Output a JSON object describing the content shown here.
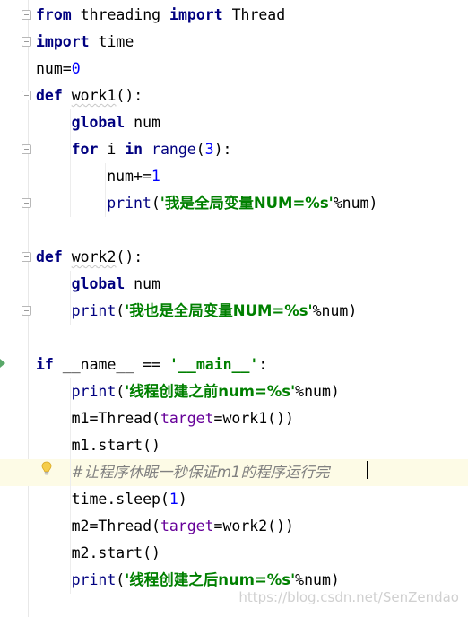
{
  "editor": {
    "language": "python",
    "lines": [
      {
        "indent": 0,
        "tokens": [
          {
            "t": "from",
            "c": "kw"
          },
          {
            "t": " threading "
          },
          {
            "t": "import",
            "c": "kw"
          },
          {
            "t": " Thread"
          }
        ]
      },
      {
        "indent": 0,
        "tokens": [
          {
            "t": "import",
            "c": "kw"
          },
          {
            "t": " time"
          }
        ]
      },
      {
        "indent": 0,
        "tokens": [
          {
            "t": "num="
          },
          {
            "t": "0",
            "c": "num"
          }
        ]
      },
      {
        "indent": 0,
        "tokens": [
          {
            "t": "def",
            "c": "kw"
          },
          {
            "t": " "
          },
          {
            "t": "work1",
            "c": "squig"
          },
          {
            "t": "():"
          }
        ]
      },
      {
        "indent": 1,
        "tokens": [
          {
            "t": "global",
            "c": "kw"
          },
          {
            "t": " num"
          }
        ]
      },
      {
        "indent": 1,
        "tokens": [
          {
            "t": "for",
            "c": "kw"
          },
          {
            "t": " i "
          },
          {
            "t": "in",
            "c": "kw"
          },
          {
            "t": " "
          },
          {
            "t": "range",
            "c": "builtin"
          },
          {
            "t": "("
          },
          {
            "t": "3",
            "c": "num"
          },
          {
            "t": "):"
          }
        ]
      },
      {
        "indent": 2,
        "tokens": [
          {
            "t": "num+="
          },
          {
            "t": "1",
            "c": "num"
          }
        ]
      },
      {
        "indent": 2,
        "tokens": [
          {
            "t": "print",
            "c": "builtin"
          },
          {
            "t": "("
          },
          {
            "t": "'我是全局变量NUM=%s'",
            "c": "str"
          },
          {
            "t": "%num)"
          }
        ]
      },
      {
        "indent": 0,
        "tokens": []
      },
      {
        "indent": 0,
        "tokens": [
          {
            "t": "def",
            "c": "kw"
          },
          {
            "t": " "
          },
          {
            "t": "work2",
            "c": "squig"
          },
          {
            "t": "():"
          }
        ]
      },
      {
        "indent": 1,
        "tokens": [
          {
            "t": "global",
            "c": "kw"
          },
          {
            "t": " num"
          }
        ]
      },
      {
        "indent": 1,
        "tokens": [
          {
            "t": "print",
            "c": "builtin"
          },
          {
            "t": "("
          },
          {
            "t": "'我也是全局变量NUM=%s'",
            "c": "str"
          },
          {
            "t": "%num)"
          }
        ]
      },
      {
        "indent": 0,
        "tokens": []
      },
      {
        "indent": 0,
        "tokens": [
          {
            "t": "if",
            "c": "kw"
          },
          {
            "t": " __name__ == "
          },
          {
            "t": "'__main__'",
            "c": "str"
          },
          {
            "t": ":"
          }
        ]
      },
      {
        "indent": 1,
        "tokens": [
          {
            "t": "print",
            "c": "builtin"
          },
          {
            "t": "("
          },
          {
            "t": "'线程创建之前num=%s'",
            "c": "str"
          },
          {
            "t": "%num)"
          }
        ]
      },
      {
        "indent": 1,
        "tokens": [
          {
            "t": "m1=Thread("
          },
          {
            "t": "target",
            "c": "param"
          },
          {
            "t": "=work1())"
          }
        ]
      },
      {
        "indent": 1,
        "tokens": [
          {
            "t": "m1.start()"
          }
        ]
      },
      {
        "indent": 1,
        "highlight": true,
        "tokens": [
          {
            "t": "#让程序休眠一秒保证m1的程序运行完",
            "c": "cmt"
          }
        ]
      },
      {
        "indent": 1,
        "tokens": [
          {
            "t": "time.sleep("
          },
          {
            "t": "1",
            "c": "num"
          },
          {
            "t": ")"
          }
        ]
      },
      {
        "indent": 1,
        "tokens": [
          {
            "t": "m2=Thread("
          },
          {
            "t": "target",
            "c": "param"
          },
          {
            "t": "=work2())"
          }
        ]
      },
      {
        "indent": 1,
        "tokens": [
          {
            "t": "m2.start()"
          }
        ]
      },
      {
        "indent": 1,
        "tokens": [
          {
            "t": "print",
            "c": "builtin"
          },
          {
            "t": "("
          },
          {
            "t": "'线程创建之后num=%s'",
            "c": "str"
          },
          {
            "t": "%num)"
          }
        ]
      }
    ],
    "fold_markers": [
      {
        "line": 0,
        "kind": "start"
      },
      {
        "line": 1,
        "kind": "end"
      },
      {
        "line": 3,
        "kind": "start"
      },
      {
        "line": 5,
        "kind": "start"
      },
      {
        "line": 7,
        "kind": "end"
      },
      {
        "line": 9,
        "kind": "start"
      },
      {
        "line": 11,
        "kind": "end"
      }
    ]
  },
  "gutter": {
    "run_line": 13,
    "intention_bulb_line": 17
  },
  "watermark": "https://blog.csdn.net/SenZendao"
}
